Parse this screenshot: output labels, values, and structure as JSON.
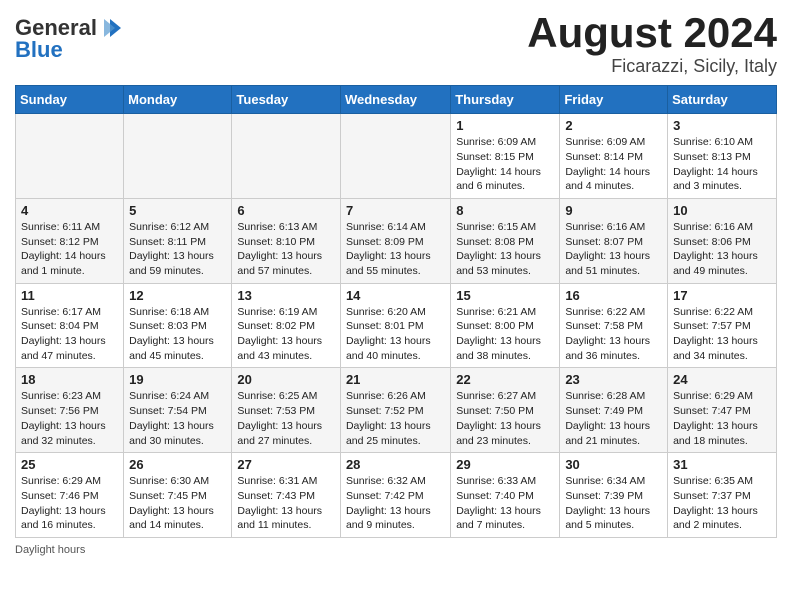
{
  "header": {
    "logo_general": "General",
    "logo_blue": "Blue",
    "month_title": "August 2024",
    "location": "Ficarazzi, Sicily, Italy"
  },
  "days_of_week": [
    "Sunday",
    "Monday",
    "Tuesday",
    "Wednesday",
    "Thursday",
    "Friday",
    "Saturday"
  ],
  "weeks": [
    [
      {
        "day": "",
        "info": ""
      },
      {
        "day": "",
        "info": ""
      },
      {
        "day": "",
        "info": ""
      },
      {
        "day": "",
        "info": ""
      },
      {
        "day": "1",
        "info": "Sunrise: 6:09 AM\nSunset: 8:15 PM\nDaylight: 14 hours\nand 6 minutes."
      },
      {
        "day": "2",
        "info": "Sunrise: 6:09 AM\nSunset: 8:14 PM\nDaylight: 14 hours\nand 4 minutes."
      },
      {
        "day": "3",
        "info": "Sunrise: 6:10 AM\nSunset: 8:13 PM\nDaylight: 14 hours\nand 3 minutes."
      }
    ],
    [
      {
        "day": "4",
        "info": "Sunrise: 6:11 AM\nSunset: 8:12 PM\nDaylight: 14 hours\nand 1 minute."
      },
      {
        "day": "5",
        "info": "Sunrise: 6:12 AM\nSunset: 8:11 PM\nDaylight: 13 hours\nand 59 minutes."
      },
      {
        "day": "6",
        "info": "Sunrise: 6:13 AM\nSunset: 8:10 PM\nDaylight: 13 hours\nand 57 minutes."
      },
      {
        "day": "7",
        "info": "Sunrise: 6:14 AM\nSunset: 8:09 PM\nDaylight: 13 hours\nand 55 minutes."
      },
      {
        "day": "8",
        "info": "Sunrise: 6:15 AM\nSunset: 8:08 PM\nDaylight: 13 hours\nand 53 minutes."
      },
      {
        "day": "9",
        "info": "Sunrise: 6:16 AM\nSunset: 8:07 PM\nDaylight: 13 hours\nand 51 minutes."
      },
      {
        "day": "10",
        "info": "Sunrise: 6:16 AM\nSunset: 8:06 PM\nDaylight: 13 hours\nand 49 minutes."
      }
    ],
    [
      {
        "day": "11",
        "info": "Sunrise: 6:17 AM\nSunset: 8:04 PM\nDaylight: 13 hours\nand 47 minutes."
      },
      {
        "day": "12",
        "info": "Sunrise: 6:18 AM\nSunset: 8:03 PM\nDaylight: 13 hours\nand 45 minutes."
      },
      {
        "day": "13",
        "info": "Sunrise: 6:19 AM\nSunset: 8:02 PM\nDaylight: 13 hours\nand 43 minutes."
      },
      {
        "day": "14",
        "info": "Sunrise: 6:20 AM\nSunset: 8:01 PM\nDaylight: 13 hours\nand 40 minutes."
      },
      {
        "day": "15",
        "info": "Sunrise: 6:21 AM\nSunset: 8:00 PM\nDaylight: 13 hours\nand 38 minutes."
      },
      {
        "day": "16",
        "info": "Sunrise: 6:22 AM\nSunset: 7:58 PM\nDaylight: 13 hours\nand 36 minutes."
      },
      {
        "day": "17",
        "info": "Sunrise: 6:22 AM\nSunset: 7:57 PM\nDaylight: 13 hours\nand 34 minutes."
      }
    ],
    [
      {
        "day": "18",
        "info": "Sunrise: 6:23 AM\nSunset: 7:56 PM\nDaylight: 13 hours\nand 32 minutes."
      },
      {
        "day": "19",
        "info": "Sunrise: 6:24 AM\nSunset: 7:54 PM\nDaylight: 13 hours\nand 30 minutes."
      },
      {
        "day": "20",
        "info": "Sunrise: 6:25 AM\nSunset: 7:53 PM\nDaylight: 13 hours\nand 27 minutes."
      },
      {
        "day": "21",
        "info": "Sunrise: 6:26 AM\nSunset: 7:52 PM\nDaylight: 13 hours\nand 25 minutes."
      },
      {
        "day": "22",
        "info": "Sunrise: 6:27 AM\nSunset: 7:50 PM\nDaylight: 13 hours\nand 23 minutes."
      },
      {
        "day": "23",
        "info": "Sunrise: 6:28 AM\nSunset: 7:49 PM\nDaylight: 13 hours\nand 21 minutes."
      },
      {
        "day": "24",
        "info": "Sunrise: 6:29 AM\nSunset: 7:47 PM\nDaylight: 13 hours\nand 18 minutes."
      }
    ],
    [
      {
        "day": "25",
        "info": "Sunrise: 6:29 AM\nSunset: 7:46 PM\nDaylight: 13 hours\nand 16 minutes."
      },
      {
        "day": "26",
        "info": "Sunrise: 6:30 AM\nSunset: 7:45 PM\nDaylight: 13 hours\nand 14 minutes."
      },
      {
        "day": "27",
        "info": "Sunrise: 6:31 AM\nSunset: 7:43 PM\nDaylight: 13 hours\nand 11 minutes."
      },
      {
        "day": "28",
        "info": "Sunrise: 6:32 AM\nSunset: 7:42 PM\nDaylight: 13 hours\nand 9 minutes."
      },
      {
        "day": "29",
        "info": "Sunrise: 6:33 AM\nSunset: 7:40 PM\nDaylight: 13 hours\nand 7 minutes."
      },
      {
        "day": "30",
        "info": "Sunrise: 6:34 AM\nSunset: 7:39 PM\nDaylight: 13 hours\nand 5 minutes."
      },
      {
        "day": "31",
        "info": "Sunrise: 6:35 AM\nSunset: 7:37 PM\nDaylight: 13 hours\nand 2 minutes."
      }
    ]
  ],
  "footer": {
    "daylight_label": "Daylight hours"
  }
}
